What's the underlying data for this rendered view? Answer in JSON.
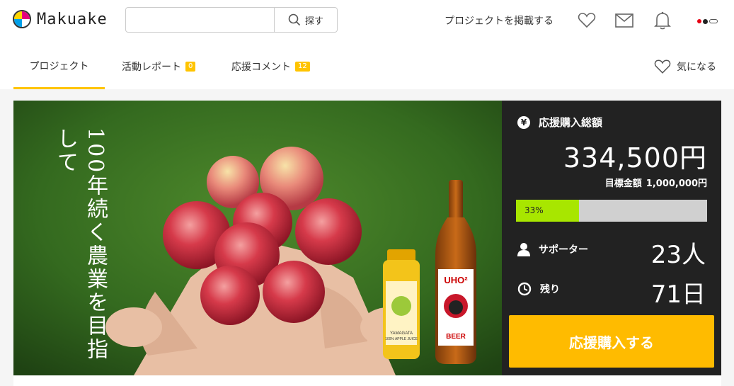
{
  "header": {
    "logo_text": "Makuake",
    "search": {
      "placeholder": "",
      "button_label": "探す"
    },
    "post_project_label": "プロジェクトを掲載する",
    "icons": [
      "heart-icon",
      "mail-icon",
      "bell-icon"
    ]
  },
  "tabs": {
    "items": [
      {
        "label": "プロジェクト",
        "active": true
      },
      {
        "label": "活動レポート",
        "badge": "0"
      },
      {
        "label": "応援コメント",
        "badge": "12"
      }
    ],
    "favorite_label": "気になる"
  },
  "hero": {
    "title": "100年続く農業を目指して",
    "product_labels": {
      "juice": "YAMAGATA 100% APPLE JUICE",
      "beer_top": "UHO",
      "beer_sup": "2",
      "beer_bottom": "BEER"
    }
  },
  "panel": {
    "total_label": "応援購入総額",
    "total_amount": "334,500円",
    "goal_label": "目標金額",
    "goal_amount": "1,000,000円",
    "progress_percent": 33,
    "progress_text": "33%",
    "supporters_label": "サポーター",
    "supporters_value": "23人",
    "remaining_label": "残り",
    "remaining_value": "71日",
    "cta_label": "応援購入する",
    "colors": {
      "progress": "#a8e600",
      "cta": "#ffbb00",
      "tab_accent": "#ffc400"
    }
  }
}
